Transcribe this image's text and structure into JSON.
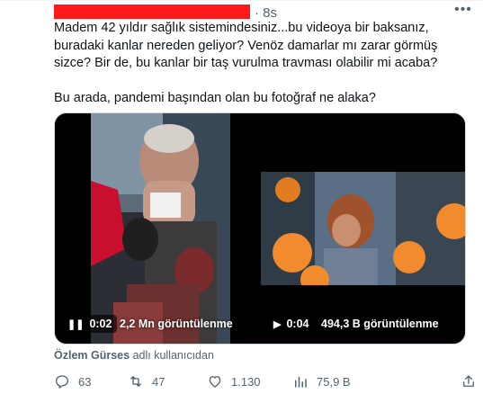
{
  "tweet": {
    "time": "8s",
    "text": "Madem 42 yıldır sağlık sistemindesiniz...bu videoya bir baksanız, buradaki kanlar nereden geliyor? Venöz damarlar mı zarar görmüş sizce? Bir de, bu kanlar bir taş vurulma travması olabilir mi acaba?\n\nBu arada, pandemi başından olan bu fotoğraf ne alaka?"
  },
  "media": {
    "left_video": {
      "time": "0:02",
      "views": "2,2 Mn görüntülenme",
      "control_icon": "pause-icon"
    },
    "right_video": {
      "time": "0:04",
      "views": "494,3 B görüntülenme",
      "control_icon": "play-icon"
    }
  },
  "attribution": {
    "name": "Özlem Gürses",
    "suffix": "adlı kullanıcıdan"
  },
  "actions": {
    "reply": "63",
    "retweet": "47",
    "like": "1.130",
    "views": "75,9 B"
  },
  "colors": {
    "redaction": "#ff1a1a",
    "muted": "#536471",
    "border": "#cfd9de"
  }
}
